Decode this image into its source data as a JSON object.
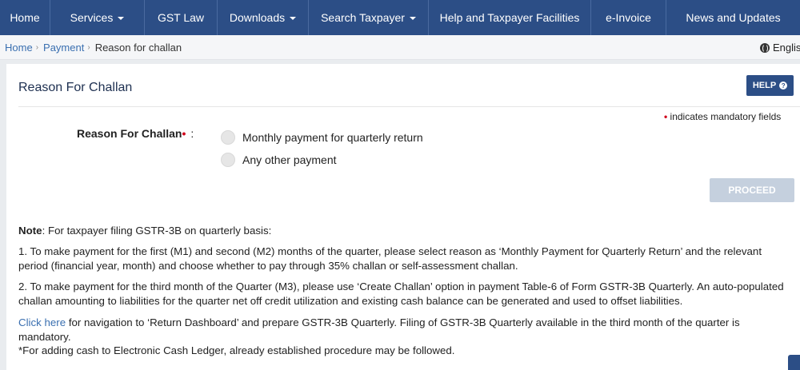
{
  "nav": {
    "items": [
      {
        "label": "Home",
        "dropdown": false
      },
      {
        "label": "Services",
        "dropdown": true
      },
      {
        "label": "GST Law",
        "dropdown": false
      },
      {
        "label": "Downloads",
        "dropdown": true
      },
      {
        "label": "Search Taxpayer",
        "dropdown": true
      },
      {
        "label": "Help and Taxpayer Facilities",
        "dropdown": false
      },
      {
        "label": "e-Invoice",
        "dropdown": false
      },
      {
        "label": "News and Updates",
        "dropdown": false
      }
    ]
  },
  "breadcrumb": {
    "items": [
      "Home",
      "Payment"
    ],
    "current": "Reason for challan",
    "separator": "›"
  },
  "language": {
    "label": "English"
  },
  "panel": {
    "title": "Reason For Challan",
    "help_label": "HELP",
    "help_icon": "?",
    "mandatory_text": "indicates mandatory fields",
    "mandatory_marker": "•"
  },
  "form": {
    "reason_label": "Reason For Challan",
    "required_marker": "•",
    "colon": ":",
    "options": [
      "Monthly payment for quarterly return",
      "Any other payment"
    ],
    "proceed_label": "PROCEED"
  },
  "note": {
    "heading": "Note",
    "intro": ": For taxpayer filing GSTR-3B on quarterly basis:",
    "point1": "1. To make payment for the first (M1) and second (M2) months of the quarter, please select reason as ‘Monthly Payment for Quarterly Return’ and the relevant period (financial year, month) and choose whether to pay through 35% challan or self-assessment challan.",
    "point2": "2. To make payment for the third month of the Quarter (M3), please use ‘Create Challan’ option in payment Table-6 of Form GSTR-3B Quarterly. An auto-populated challan amounting to liabilities for the quarter net off credit utilization and existing cash balance can be generated and used to offset liabilities.",
    "link_text": "Click here",
    "link_rest": " for navigation to ‘Return Dashboard’ and prepare GSTR-3B Quarterly. Filing of GSTR-3B Quarterly available in the third month of the quarter is mandatory.",
    "footnote": "*For adding cash to Electronic Cash Ledger, already established procedure may be followed."
  },
  "colors": {
    "nav_bg": "#2c4e86",
    "link": "#3a6fb0",
    "required": "#d0021b",
    "proceed_disabled": "#c5d0de"
  }
}
